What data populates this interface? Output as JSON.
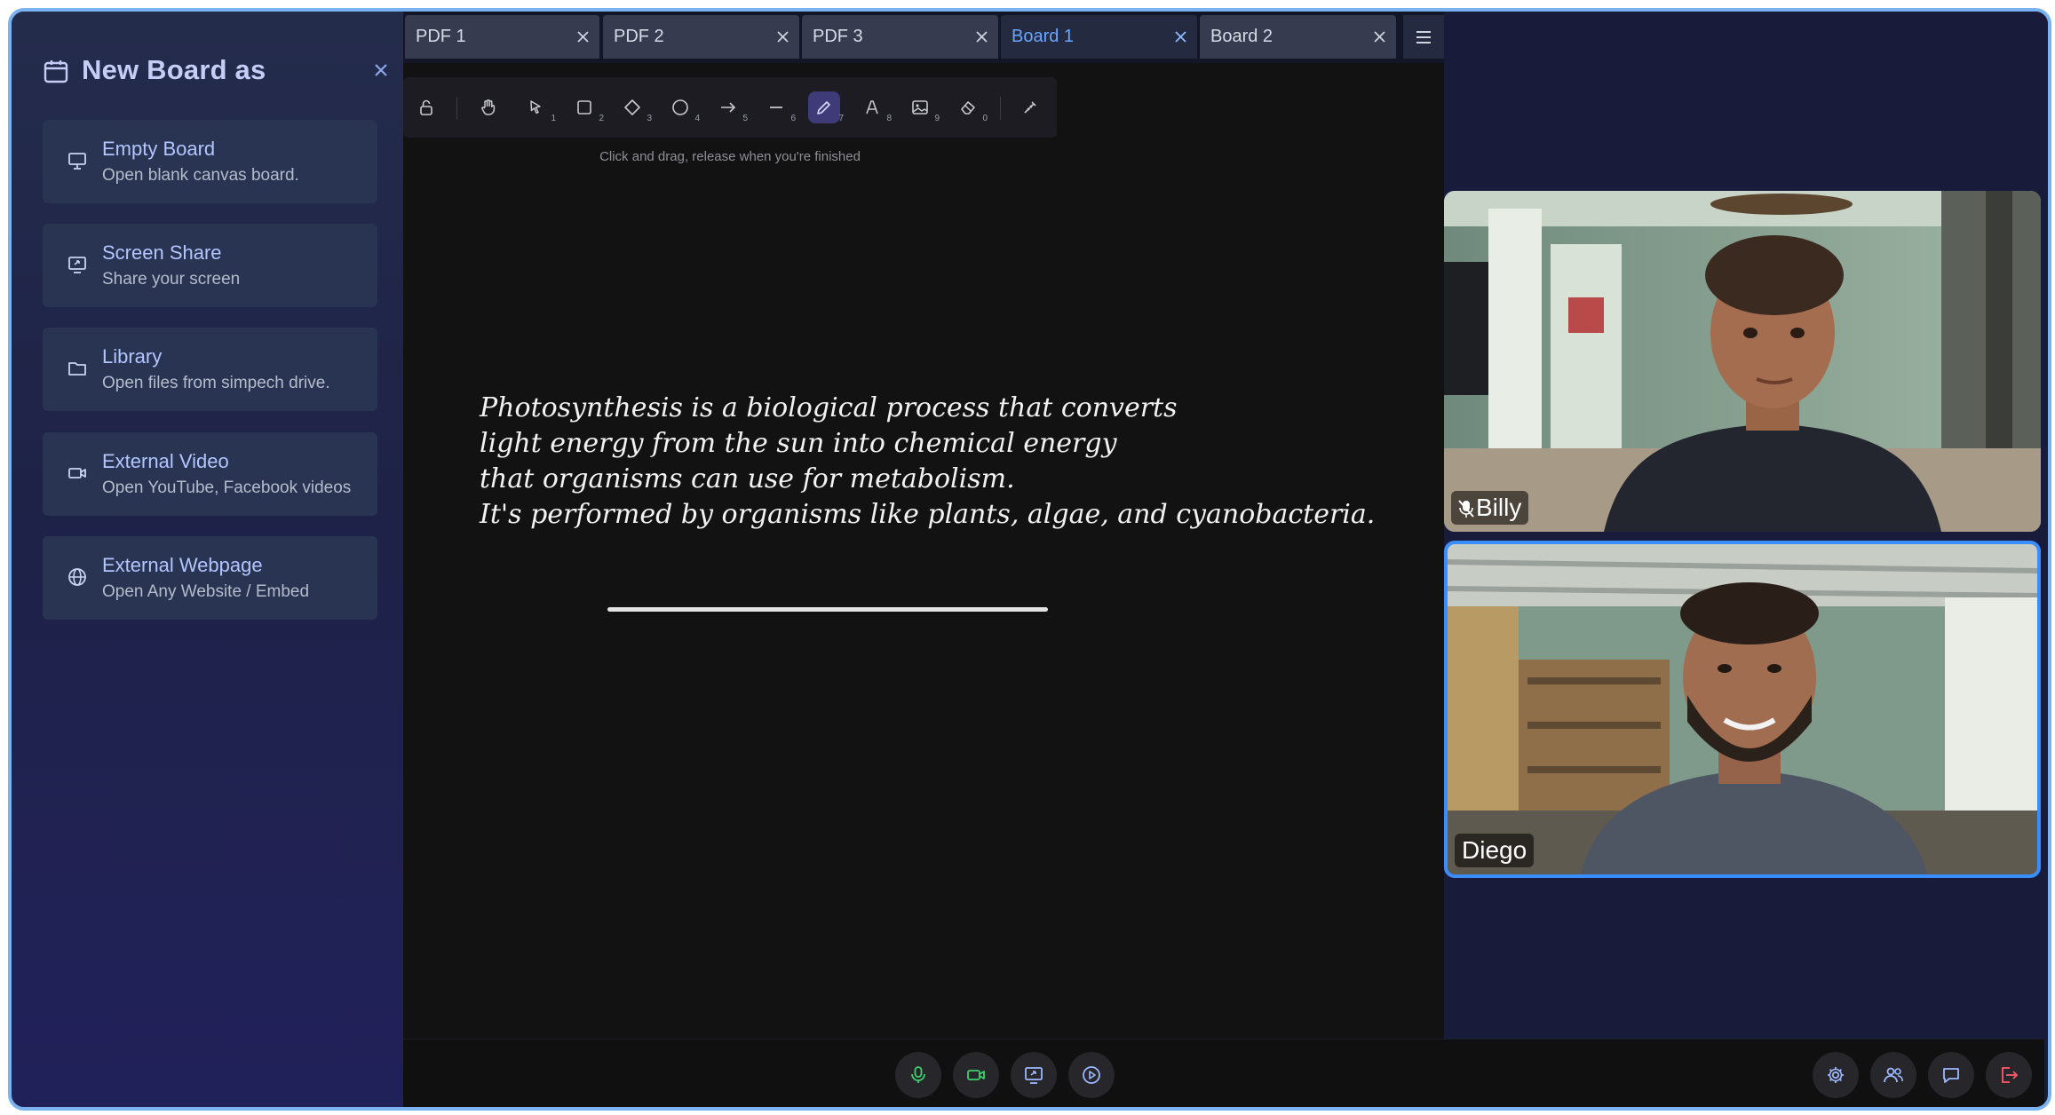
{
  "panel": {
    "title": "New Board as",
    "options": [
      {
        "title": "Empty Board",
        "desc": "Open blank canvas board.",
        "icon": "whiteboard-icon"
      },
      {
        "title": "Screen Share",
        "desc": "Share your screen",
        "icon": "screen-share-icon"
      },
      {
        "title": "Library",
        "desc": "Open files from simpech drive.",
        "icon": "folder-icon"
      },
      {
        "title": "External Video",
        "desc": "Open YouTube, Facebook videos",
        "icon": "video-icon"
      },
      {
        "title": "External Webpage",
        "desc": "Open Any Website / Embed",
        "icon": "globe-icon"
      }
    ]
  },
  "tabs": [
    {
      "label": "PDF 1",
      "active": false
    },
    {
      "label": "PDF 2",
      "active": false
    },
    {
      "label": "PDF 3",
      "active": false
    },
    {
      "label": "Board 1",
      "active": true
    },
    {
      "label": "Board 2",
      "active": false
    }
  ],
  "toolbar": {
    "tools": [
      {
        "name": "lock",
        "shortcut": ""
      },
      {
        "name": "hand",
        "shortcut": ""
      },
      {
        "name": "selection",
        "shortcut": "1"
      },
      {
        "name": "rectangle",
        "shortcut": "2"
      },
      {
        "name": "diamond",
        "shortcut": "3"
      },
      {
        "name": "ellipse",
        "shortcut": "4"
      },
      {
        "name": "arrow",
        "shortcut": "5"
      },
      {
        "name": "line",
        "shortcut": "6"
      },
      {
        "name": "draw",
        "shortcut": "7"
      },
      {
        "name": "text",
        "shortcut": "8"
      },
      {
        "name": "image",
        "shortcut": "9"
      },
      {
        "name": "eraser",
        "shortcut": "0"
      },
      {
        "name": "laser",
        "shortcut": ""
      }
    ],
    "active_tool": "draw"
  },
  "canvas": {
    "hint": "Click and drag, release when you're finished",
    "lines": [
      "Photosynthesis is a biological process that converts",
      "light energy from the sun into chemical energy",
      "that organisms can use for metabolism.",
      "It's performed by organisms like plants, algae, and cyanobacteria."
    ]
  },
  "participants": [
    {
      "name": "Billy",
      "muted": true
    },
    {
      "name": "Diego",
      "muted": false,
      "speaking": true
    }
  ],
  "controls": {
    "center": [
      "mic",
      "camera",
      "screen-share",
      "record"
    ],
    "right": [
      "settings",
      "participants",
      "chat",
      "leave"
    ]
  },
  "colors": {
    "accent": "#6aa6ff",
    "active_tool": "#3f3b79",
    "speaking_border": "#3a8dff",
    "mic": "#3ecf6e",
    "leave": "#ff5a6a"
  }
}
